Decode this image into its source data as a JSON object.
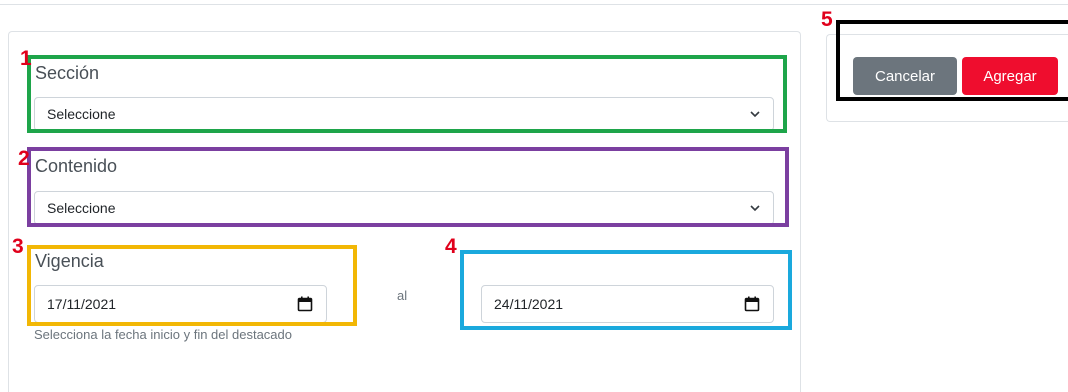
{
  "form": {
    "seccion": {
      "label": "Sección",
      "value": "Seleccione"
    },
    "contenido": {
      "label": "Contenido",
      "value": "Seleccione"
    },
    "vigencia": {
      "label": "Vigencia",
      "start_date": "17/11/2021",
      "separator": "al",
      "end_date": "24/11/2021",
      "help_text": "Selecciona la fecha inicio y fin del destacado"
    }
  },
  "actions": {
    "cancel_label": "Cancelar",
    "add_label": "Agregar"
  },
  "annotations": {
    "box1": {
      "number": "1",
      "color": "#1ea54a"
    },
    "box2": {
      "number": "2",
      "color": "#7b3fa0"
    },
    "box3": {
      "number": "3",
      "color": "#f2b705"
    },
    "box4": {
      "number": "4",
      "color": "#1aa9dd"
    },
    "box5": {
      "number": "5",
      "color": "#000000"
    }
  },
  "colors": {
    "marker_number": "#e0001b",
    "cancel_bg": "#6c757d",
    "add_bg": "#ef0d2e"
  },
  "icons": {
    "select_icon": "chevron-down-icon",
    "date_icon": "calendar-icon"
  }
}
